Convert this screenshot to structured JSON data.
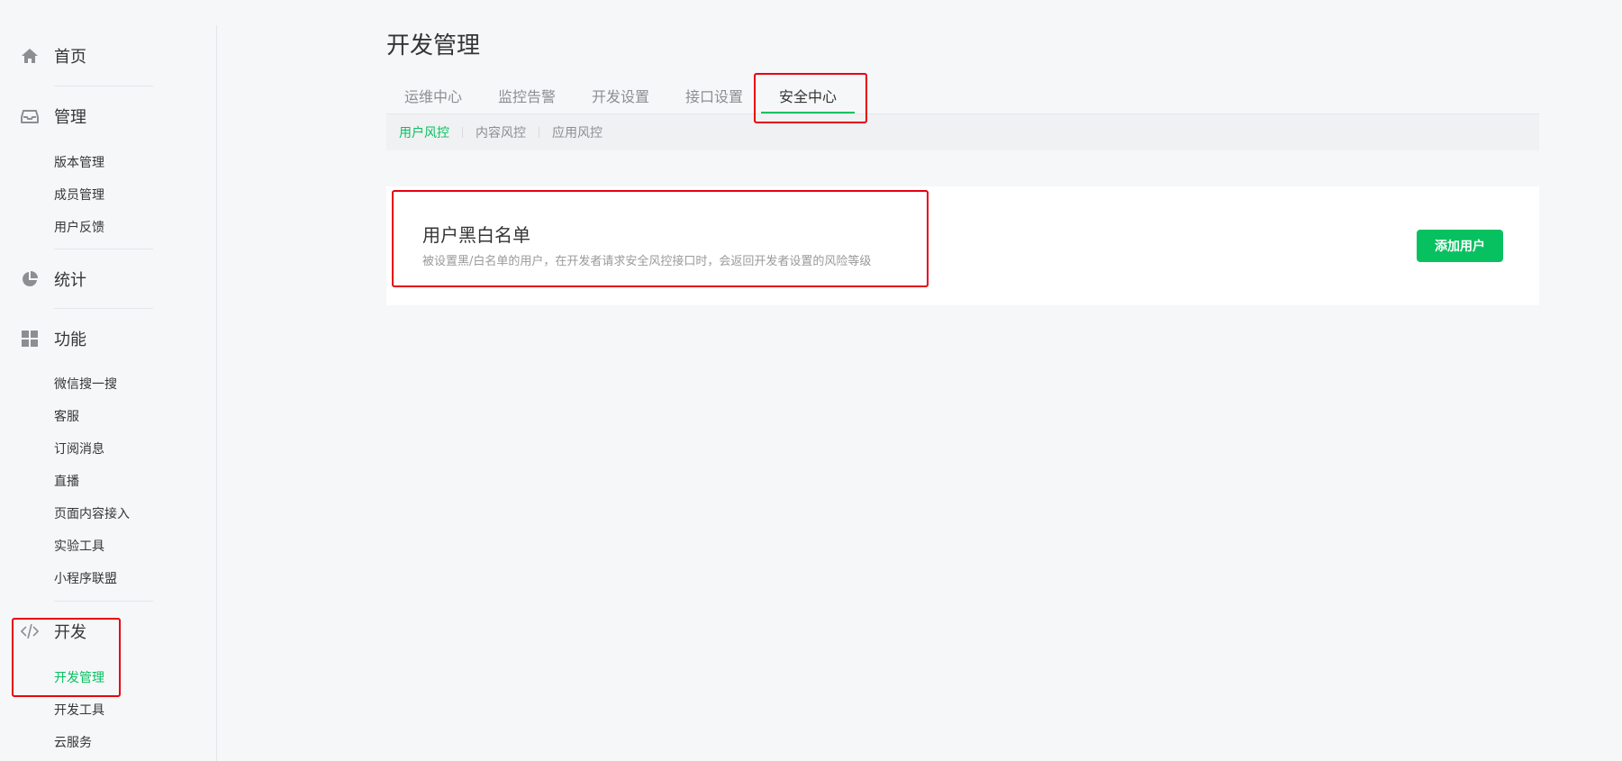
{
  "sidebar": {
    "home": {
      "label": "首页",
      "icon": "home-icon"
    },
    "manage": {
      "label": "管理",
      "icon": "inbox-icon",
      "items": [
        "版本管理",
        "成员管理",
        "用户反馈"
      ]
    },
    "stats": {
      "label": "统计",
      "icon": "pie-chart-icon"
    },
    "features": {
      "label": "功能",
      "icon": "grid-icon",
      "items": [
        "微信搜一搜",
        "客服",
        "订阅消息",
        "直播",
        "页面内容接入",
        "实验工具",
        "小程序联盟"
      ]
    },
    "dev": {
      "label": "开发",
      "icon": "code-icon",
      "items": [
        "开发管理",
        "开发工具",
        "云服务"
      ],
      "active_item": "开发管理"
    }
  },
  "main": {
    "title": "开发管理",
    "tabs": [
      "运维中心",
      "监控告警",
      "开发设置",
      "接口设置",
      "安全中心"
    ],
    "active_tab": "安全中心",
    "subtabs": [
      "用户风控",
      "内容风控",
      "应用风控"
    ],
    "active_subtab": "用户风控",
    "card": {
      "title": "用户黑白名单",
      "description": "被设置黑/白名单的用户，在开发者请求安全风控接口时，会返回开发者设置的风险等级",
      "button_label": "添加用户"
    }
  },
  "colors": {
    "accent": "#07c160",
    "highlight": "#e60012",
    "background": "#f6f7f9"
  }
}
